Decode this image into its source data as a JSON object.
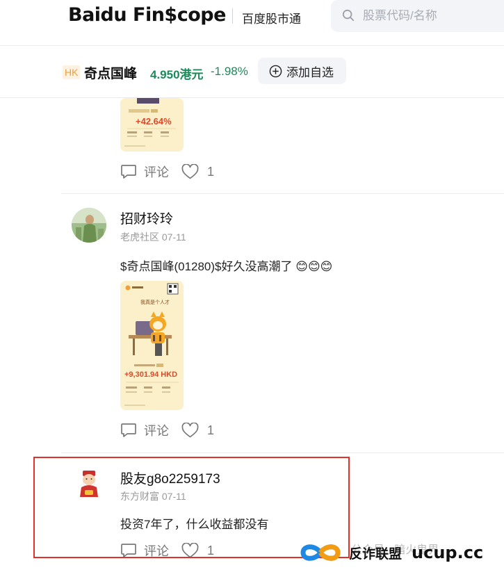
{
  "header": {
    "logo": "Baidu Fin$cope",
    "sub_title": "百度股市通",
    "search_placeholder": "股票代码/名称"
  },
  "stock": {
    "market": "HK",
    "name": "奇点国峰",
    "price": "4.950港元",
    "change": "-1.98%",
    "watch_label": "添加自选"
  },
  "posts": [
    {
      "image": {
        "gain_label": "+42.64%"
      },
      "comment_label": "评论",
      "like_count": "1"
    },
    {
      "user": "招财玲玲",
      "source": "老虎社区",
      "date": "07-11",
      "content": "$奇点国峰(01280)$好久没高潮了 😊😊😊",
      "image": {
        "headline": "我真是个人才",
        "gain_label": "+9,301.94 HKD"
      },
      "comment_label": "评论",
      "like_count": "1"
    },
    {
      "user": "股友g8o2259173",
      "source": "东方财富",
      "date": "07-11",
      "content": "投资7年了，什么收益都没有",
      "comment_label": "评论",
      "like_count": "1"
    }
  ],
  "watermark": {
    "text": "公众号 · 暗火鬼界",
    "brand_name": "反诈联盟",
    "brand_url": "ucup.cc"
  },
  "colors": {
    "down": "#1a8a5a",
    "highlight": "#e0322b",
    "badge": "#e6a23c"
  }
}
